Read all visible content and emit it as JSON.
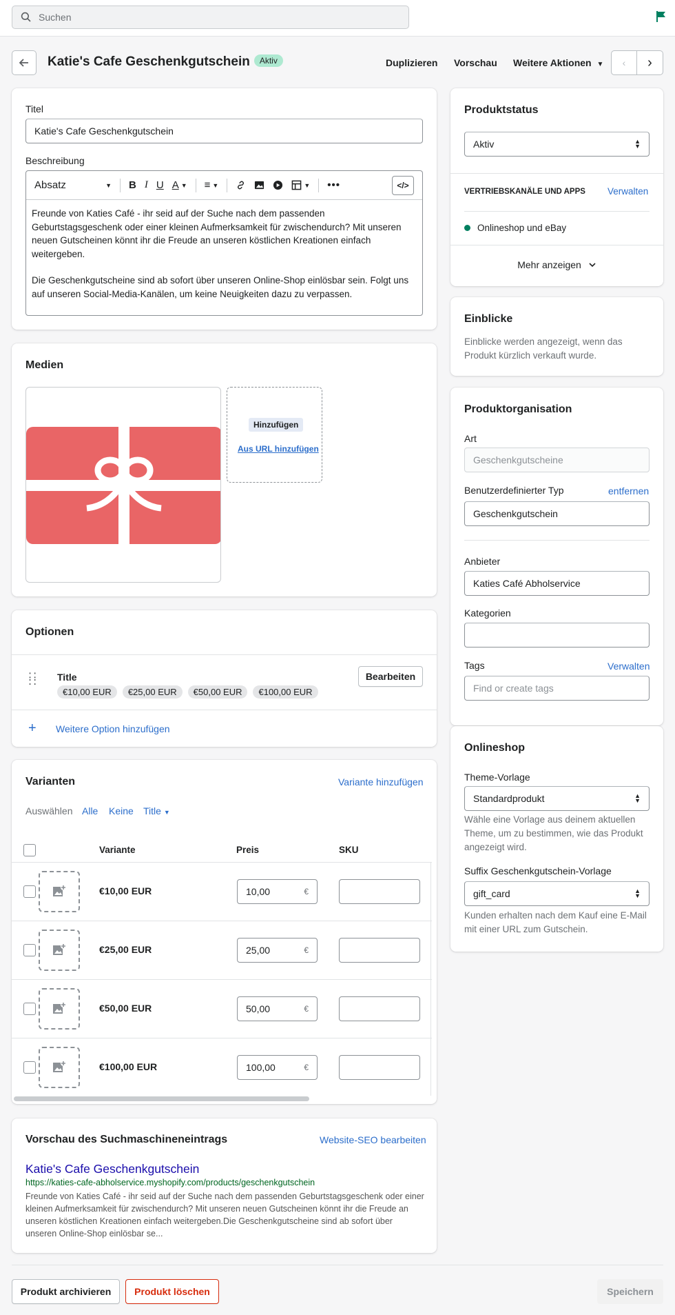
{
  "topbar": {
    "search_placeholder": "Suchen"
  },
  "header": {
    "title": "Katie's Cafe Geschenkgutschein",
    "status_badge": "Aktiv",
    "duplicate": "Duplizieren",
    "preview": "Vorschau",
    "more_actions": "Weitere Aktionen"
  },
  "general": {
    "title_label": "Titel",
    "title_value": "Katie's Cafe Geschenkgutschein",
    "description_label": "Beschreibung",
    "format_select": "Absatz",
    "description_p1": "Freunde von Katies Café - ihr seid auf der Suche nach dem passenden Geburtstagsgeschenk oder einer kleinen Aufmerksamkeit für zwischendurch? Mit unseren neuen Gutscheinen könnt ihr die Freude an unseren köstlichen Kreationen einfach weitergeben.",
    "description_p2": "Die Geschenkgutscheine sind ab sofort über unseren Online-Shop einlösbar sein. Folgt uns auf unseren Social-Media-Kanälen, um keine Neuigkeiten dazu zu verpassen."
  },
  "media": {
    "heading": "Medien",
    "add_button": "Hinzufügen",
    "add_url": "Aus URL hinzufügen",
    "card_color": "#e96566"
  },
  "options": {
    "heading": "Optionen",
    "option_name": "Title",
    "values": [
      "€10,00 EUR",
      "€25,00 EUR",
      "€50,00 EUR",
      "€100,00 EUR"
    ],
    "edit_button": "Bearbeiten",
    "add_option": "Weitere Option hinzufügen"
  },
  "variants": {
    "heading": "Varianten",
    "add_variant": "Variante hinzufügen",
    "select_label": "Auswählen",
    "select_all": "Alle",
    "select_none": "Keine",
    "select_title": "Title",
    "col_variant": "Variante",
    "col_price": "Preis",
    "col_sku": "SKU",
    "currency_symbol": "€",
    "rows": [
      {
        "name": "€10,00 EUR",
        "price": "10,00"
      },
      {
        "name": "€25,00 EUR",
        "price": "25,00"
      },
      {
        "name": "€50,00 EUR",
        "price": "50,00"
      },
      {
        "name": "€100,00 EUR",
        "price": "100,00"
      }
    ]
  },
  "seo": {
    "heading": "Vorschau des Suchmaschineneintrags",
    "edit_link": "Website-SEO bearbeiten",
    "page_title": "Katie's Cafe Geschenkgutschein",
    "url": "https://katies-cafe-abholservice.myshopify.com/products/geschenkgutschein",
    "description": "Freunde von Katies Café - ihr seid auf der Suche nach dem passenden Geburtstagsgeschenk oder einer kleinen Aufmerksamkeit für zwischendurch? Mit unseren neuen Gutscheinen könnt ihr die Freude an unseren köstlichen Kreationen einfach weitergeben.Die Geschenkgutscheine sind ab sofort über unseren Online-Shop einlösbar se..."
  },
  "status": {
    "heading": "Produktstatus",
    "value": "Aktiv",
    "channels_heading": "VERTRIEBSKANÄLE UND APPS",
    "manage": "Verwalten",
    "channel": "Onlineshop und eBay",
    "show_more": "Mehr anzeigen"
  },
  "insights": {
    "heading": "Einblicke",
    "text": "Einblicke werden angezeigt, wenn das Produkt kürzlich verkauft wurde."
  },
  "organization": {
    "heading": "Produktorganisation",
    "type_label": "Art",
    "type_placeholder": "Geschenkgutscheine",
    "custom_type_label": "Benutzerdefinierter Typ",
    "remove": "entfernen",
    "custom_type_value": "Geschenkgutschein",
    "vendor_label": "Anbieter",
    "vendor_value": "Katies Café Abholservice",
    "collections_label": "Kategorien",
    "tags_label": "Tags",
    "tags_manage": "Verwalten",
    "tags_placeholder": "Find or create tags"
  },
  "onlinestore": {
    "heading": "Onlineshop",
    "template_label": "Theme-Vorlage",
    "template_value": "Standardprodukt",
    "template_help": "Wähle eine Vorlage aus deinem aktuellen Theme, um zu bestimmen, wie das Produkt angezeigt wird.",
    "suffix_label": "Suffix Geschenkgutschein-Vorlage",
    "suffix_value": "gift_card",
    "suffix_help": "Kunden erhalten nach dem Kauf eine E-Mail mit einer URL zum Gutschein."
  },
  "footer": {
    "archive": "Produkt archivieren",
    "delete": "Produkt löschen",
    "save": "Speichern"
  }
}
